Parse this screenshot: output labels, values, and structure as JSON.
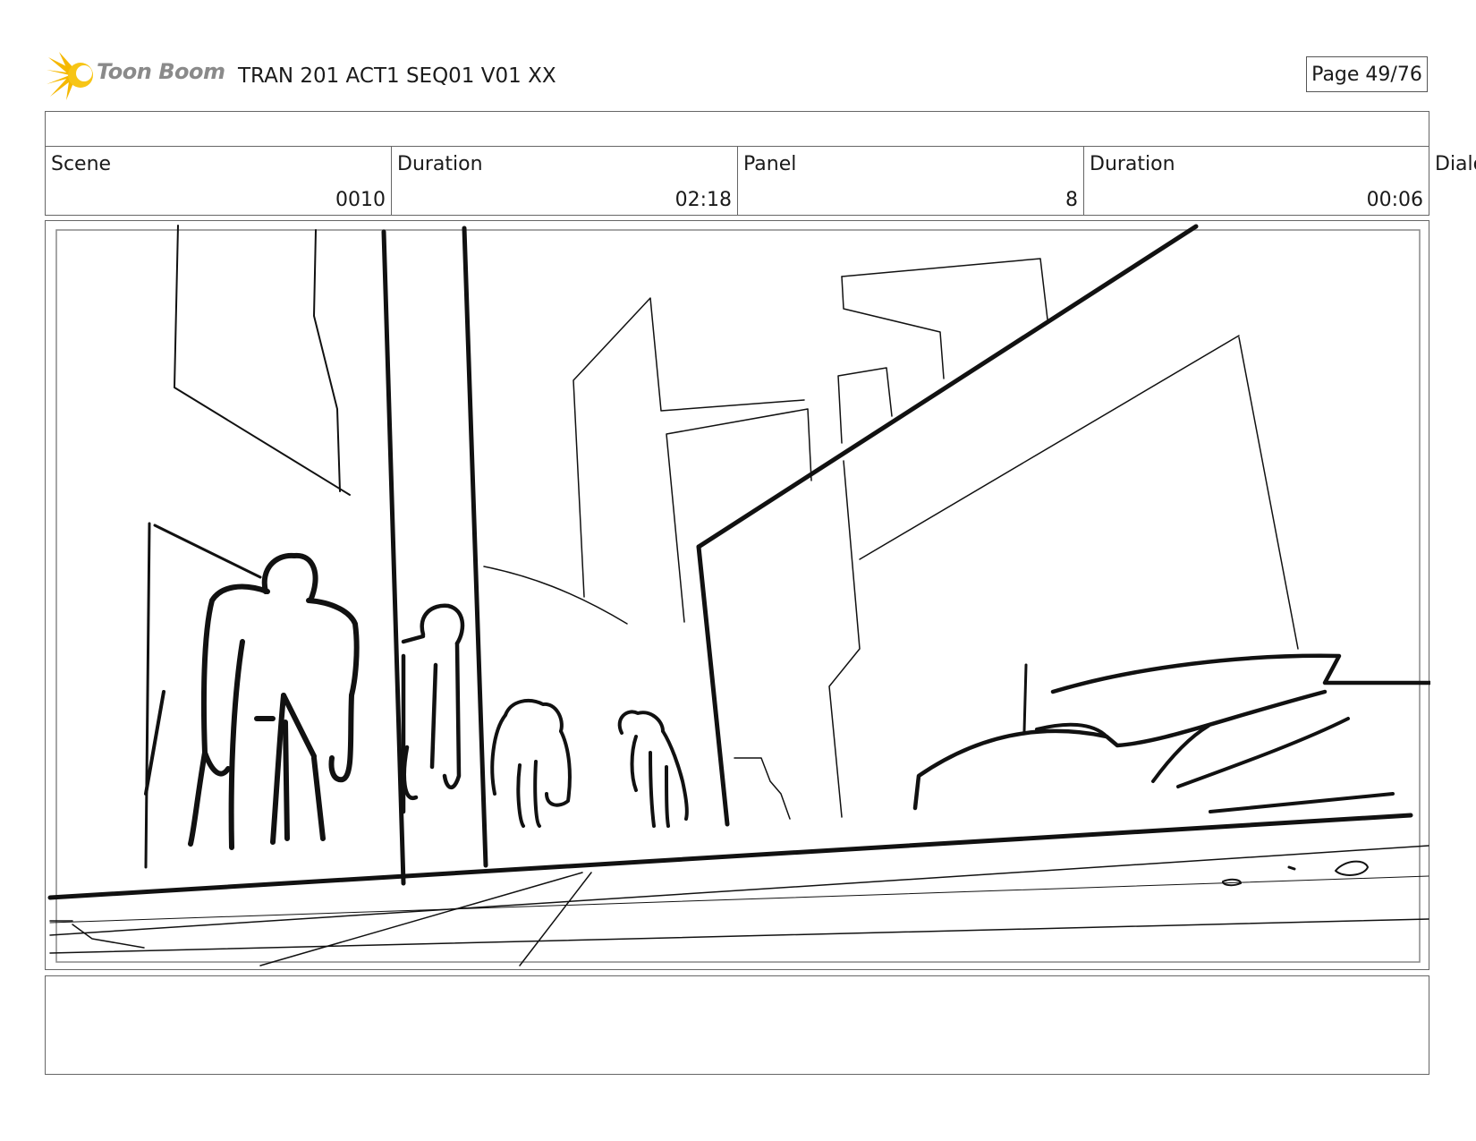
{
  "header": {
    "logo_text": "Toon Boom",
    "document_title": "TRAN 201 ACT1 SEQ01 V01 XX",
    "page_label": "Page 49/76"
  },
  "info": {
    "scene_label": "Scene",
    "scene_value": "0010",
    "scene_duration_label": "Duration",
    "scene_duration_value": "02:18",
    "panel_label": "Panel",
    "panel_value": "8",
    "panel_duration_label": "Duration",
    "panel_duration_value": "00:06",
    "dialog_label": "Dialo"
  },
  "colors": {
    "logo_burst": "#f5b800",
    "logo_text": "#8a8a8a",
    "border": "#666666",
    "sketch": "#111111"
  }
}
